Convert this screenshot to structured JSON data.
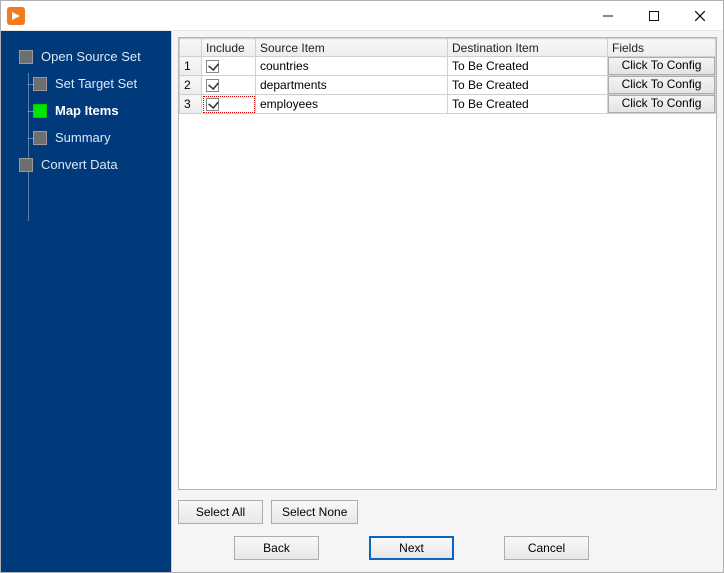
{
  "title": "",
  "sidebar": {
    "items": [
      {
        "label": "Open Source Set",
        "active": false,
        "child": false
      },
      {
        "label": "Set Target Set",
        "active": false,
        "child": true
      },
      {
        "label": "Map Items",
        "active": true,
        "child": true
      },
      {
        "label": "Summary",
        "active": false,
        "child": true
      },
      {
        "label": "Convert Data",
        "active": false,
        "child": false
      }
    ]
  },
  "grid": {
    "headers": {
      "include": "Include",
      "source": "Source Item",
      "dest": "Destination Item",
      "fields": "Fields"
    },
    "rows": [
      {
        "n": "1",
        "include": true,
        "source": "countries",
        "dest": "To Be Created",
        "fields": "Click To Config",
        "focus": false
      },
      {
        "n": "2",
        "include": true,
        "source": "departments",
        "dest": "To Be Created",
        "fields": "Click To Config",
        "focus": false
      },
      {
        "n": "3",
        "include": true,
        "source": "employees",
        "dest": "To Be Created",
        "fields": "Click To Config",
        "focus": true
      }
    ]
  },
  "buttons": {
    "select_all": "Select All",
    "select_none": "Select None",
    "back": "Back",
    "next": "Next",
    "cancel": "Cancel"
  }
}
